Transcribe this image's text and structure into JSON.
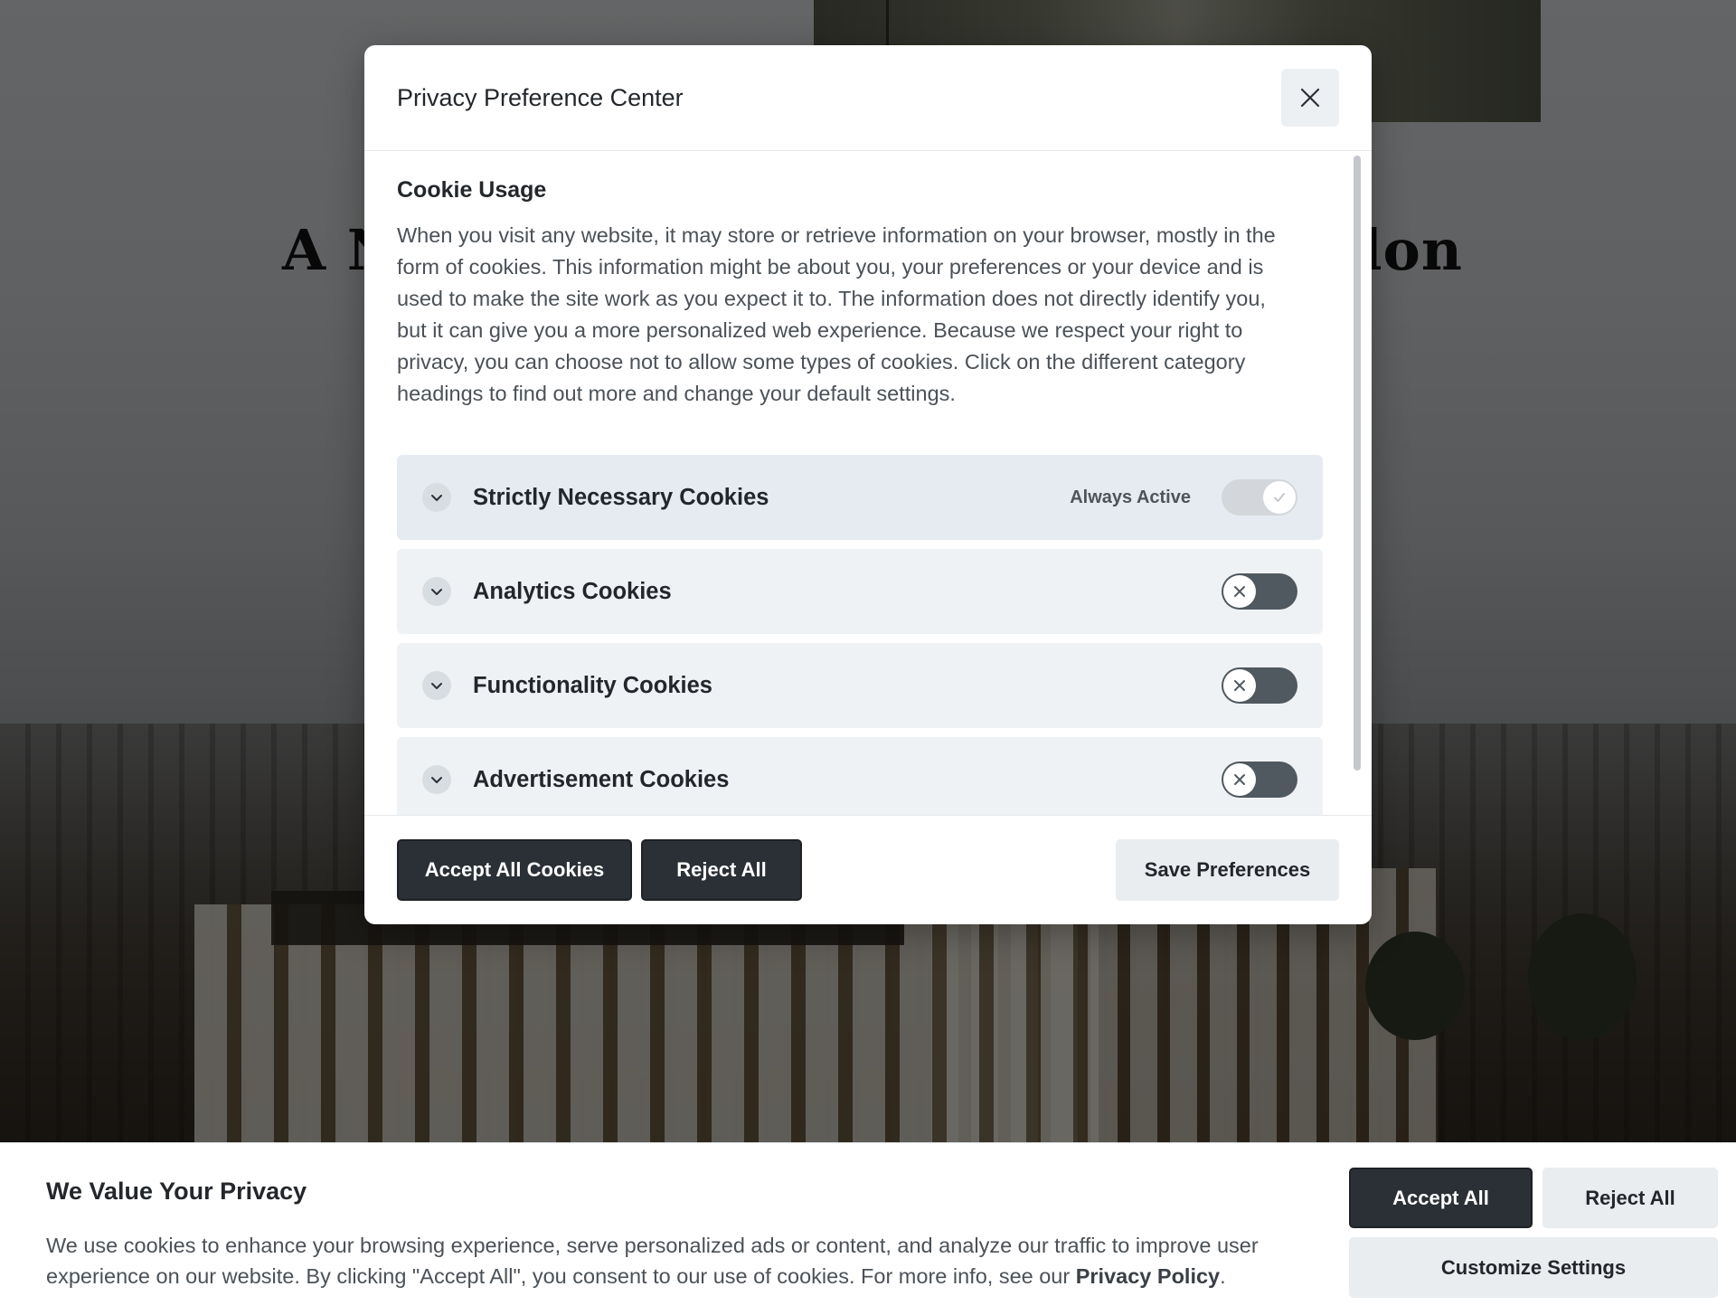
{
  "background_page": {
    "headline_left": "A N",
    "headline_right": "lon"
  },
  "modal": {
    "title": "Privacy Preference Center",
    "close_icon": "close-icon",
    "section_title": "Cookie Usage",
    "section_description": "When you visit any website, it may store or retrieve information on your browser, mostly in the form of cookies. This information might be about you, your preferences or your device and is used to make the site work as you expect it to. The information does not directly identify you, but it can give you a more personalized web experience. Because we respect your right to privacy, you can choose not to allow some types of cookies. Click on the different category headings to find out more and change your default settings.",
    "categories": [
      {
        "label": "Strictly Necessary Cookies",
        "status_text": "Always Active",
        "enabled": true,
        "icon": "chevron-down-icon"
      },
      {
        "label": "Analytics Cookies",
        "status_text": "",
        "enabled": false,
        "icon": "chevron-down-icon"
      },
      {
        "label": "Functionality Cookies",
        "status_text": "",
        "enabled": false,
        "icon": "chevron-down-icon"
      },
      {
        "label": "Advertisement Cookies",
        "status_text": "",
        "enabled": false,
        "icon": "chevron-down-icon"
      }
    ],
    "buttons": {
      "accept_all": "Accept All Cookies",
      "reject_all": "Reject All",
      "save": "Save Preferences"
    }
  },
  "banner": {
    "title": "We Value Your Privacy",
    "text_before_link": "We use cookies to enhance your browsing experience, serve personalized ads or content, and analyze our traffic to improve user experience on our website. By clicking \"Accept All\", you consent to our use of cookies. For more info, see our ",
    "link_text": "Privacy Policy",
    "text_after_link": ".",
    "buttons": {
      "accept_all": "Accept All",
      "reject_all": "Reject All",
      "customize": "Customize Settings"
    }
  },
  "colors": {
    "dark_button": "#2b3036",
    "light_button": "#e9edf0",
    "toggle_off": "#50595f",
    "toggle_on": "#d3d7db"
  }
}
